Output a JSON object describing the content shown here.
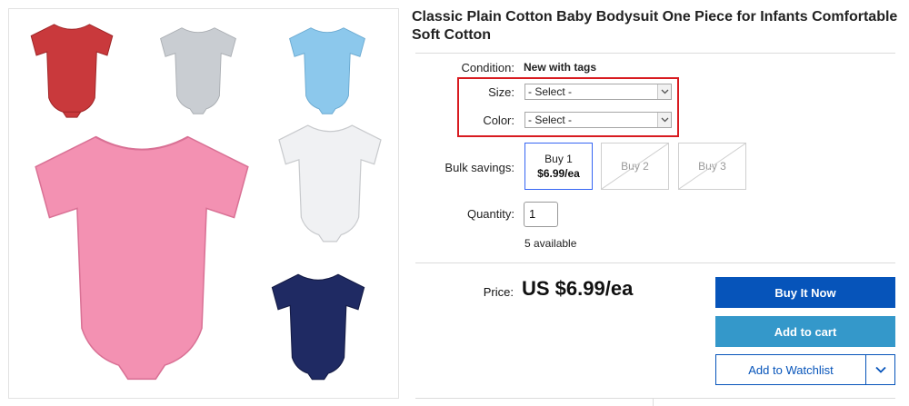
{
  "listing": {
    "title": "Classic Plain Cotton Baby Bodysuit One Piece for Infants Comfortable Soft Cotton"
  },
  "gallery": {
    "colors": [
      "#c9393c",
      "#c9cdd2",
      "#8cc8ec",
      "#f0f1f3",
      "#f391b2",
      "#1f2a63"
    ]
  },
  "details": {
    "condition_label": "Condition:",
    "condition_value": "New with tags",
    "size_label": "Size:",
    "size_value": "- Select -",
    "color_label": "Color:",
    "color_value": "- Select -",
    "bulk_label": "Bulk savings:",
    "bulk_options": [
      {
        "line1": "Buy 1",
        "line2": "$6.99/ea"
      },
      {
        "line1": "Buy 2",
        "line2": ""
      },
      {
        "line1": "Buy 3",
        "line2": ""
      }
    ],
    "quantity_label": "Quantity:",
    "quantity_value": "1",
    "available": "5 available"
  },
  "purchase": {
    "price_label": "Price:",
    "price": "US $6.99/ea",
    "buy_now": "Buy It Now",
    "add_to_cart": "Add to cart",
    "watchlist": "Add to Watchlist"
  },
  "colors": {
    "highlight": "#d81b20",
    "buy_now_bg": "#0654ba",
    "cart_bg": "#3498ca",
    "active_outline": "#3665f3"
  }
}
